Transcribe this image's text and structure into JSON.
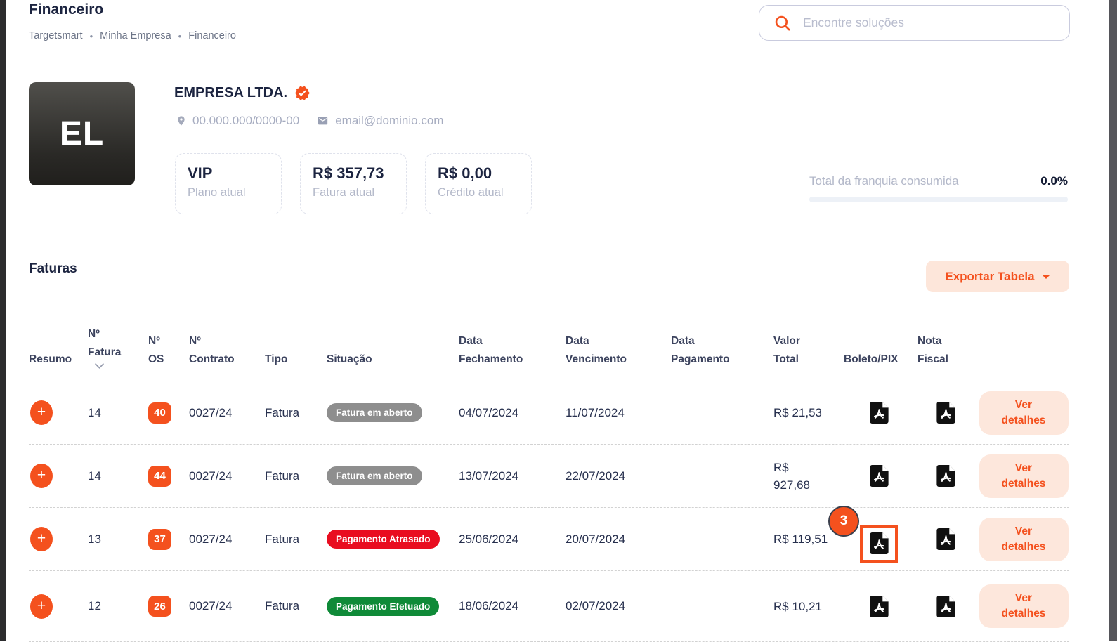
{
  "page": {
    "title": "Financeiro",
    "breadcrumb": [
      "Targetsmart",
      "Minha Empresa",
      "Financeiro"
    ],
    "breadcrumb_separator": "•",
    "search_placeholder": "Encontre soluções"
  },
  "company": {
    "initials": "EL",
    "name": "EMPRESA LTDA.",
    "cnpj": "00.000.000/0000-00",
    "email": "email@dominio.com",
    "stats": [
      {
        "value": "VIP",
        "label": "Plano atual"
      },
      {
        "value": "R$ 357,73",
        "label": "Fatura atual"
      },
      {
        "value": "R$ 0,00",
        "label": "Crédito atual"
      }
    ],
    "franquia_label": "Total da franquia consumida",
    "franquia_value": "0.0%",
    "franquia_percent": 0
  },
  "faturas": {
    "title": "Faturas",
    "export_button": "Exportar Tabela",
    "expand_label": "+",
    "headers": [
      "Resumo",
      "Nº\nFatura",
      "Nº\nOS",
      "Nº\nContrato",
      "Tipo",
      "Situação",
      "Data\nFechamento",
      "Data\nVencimento",
      "Data\nPagamento",
      "Valor\nTotal",
      "Boleto/PIX",
      "Nota\nFiscal",
      ""
    ],
    "rows": [
      {
        "fatura": "14",
        "os": "40",
        "contrato": "0027/24",
        "tipo": "Fatura",
        "situacao": "Fatura em aberto",
        "situacao_class": "pill pill-gray",
        "fechamento": "04/07/2024",
        "vencimento": "11/07/2024",
        "pagamento": "",
        "valor": "R$ 21,53",
        "detalhes": "Ver detalhes"
      },
      {
        "fatura": "14",
        "os": "44",
        "contrato": "0027/24",
        "tipo": "Fatura",
        "situacao": "Fatura em aberto",
        "situacao_class": "pill pill-gray",
        "fechamento": "13/07/2024",
        "vencimento": "22/07/2024",
        "pagamento": "",
        "valor": "R$\n927,68",
        "detalhes": "Ver detalhes"
      },
      {
        "fatura": "13",
        "os": "37",
        "contrato": "0027/24",
        "tipo": "Fatura",
        "situacao": "Pagamento Atrasado",
        "situacao_class": "pill pill-red",
        "fechamento": "25/06/2024",
        "vencimento": "20/07/2024",
        "pagamento": "",
        "valor": "R$ 119,51",
        "detalhes": "Ver detalhes"
      },
      {
        "fatura": "12",
        "os": "26",
        "contrato": "0027/24",
        "tipo": "Fatura",
        "situacao": "Pagamento Efetuado",
        "situacao_class": "pill pill-green",
        "fechamento": "18/06/2024",
        "vencimento": "02/07/2024",
        "pagamento": "",
        "valor": "R$ 10,21",
        "detalhes": "Ver detalhes"
      }
    ]
  },
  "annotation": {
    "step_badge": "3"
  },
  "colors": {
    "primary_orange": "#f4511e",
    "navy_text": "#1c2440",
    "pill_gray": "#8e8e8e",
    "pill_red": "#e90d20",
    "pill_green": "#0f8a38",
    "button_peach": "#fde6da",
    "progress_track": "#edf1f7"
  }
}
